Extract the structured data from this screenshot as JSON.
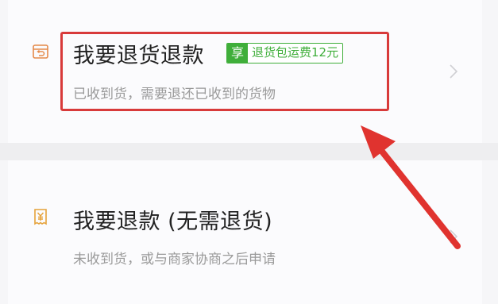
{
  "options": [
    {
      "icon": "return-box-icon",
      "title": "我要退货退款",
      "badge": {
        "tag": "享",
        "text": "退货包运费12元"
      },
      "subtitle": "已收到货，需要退还已收到的货物"
    },
    {
      "icon": "yen-receipt-icon",
      "title": "我要退款 (无需退货)",
      "subtitle": "未收到货，或与商家协商之后申请"
    }
  ],
  "colors": {
    "accent_orange": "#e58a4a",
    "badge_green": "#3fae3a",
    "annotation_red": "#d83a3a",
    "title_text": "#222222",
    "subtitle_text": "#9a9a9a"
  }
}
